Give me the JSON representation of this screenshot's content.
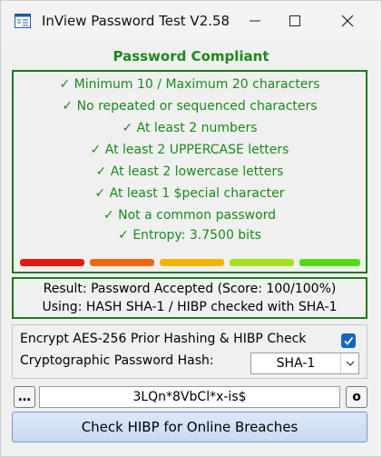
{
  "window": {
    "title": "InView Password Test V2.58"
  },
  "status": {
    "title": "Password Compliant"
  },
  "rules": [
    "✓ Minimum 10 / Maximum 20 characters",
    "✓ No repeated or sequenced characters",
    "✓ At least 2 numbers",
    "✓ At least 2 UPPERCASE letters",
    "✓ At least 2 lowercase letters",
    "✓ At least 1 $pecial character",
    "✓ Not a common password",
    "✓ Entropy: 3.7500 bits"
  ],
  "strength_meter": {
    "colors": [
      "#e31b0c",
      "#f06a10",
      "#f5b400",
      "#a8e020",
      "#50dc10"
    ],
    "level": 5
  },
  "result": {
    "line1": "Result: Password Accepted (Score: 100/100%)",
    "line2": "Using: HASH SHA-1 / HIBP checked with SHA-1"
  },
  "options": {
    "encrypt_label": "Encrypt AES-256 Prior Hashing & HIBP Check",
    "encrypt_checked": true,
    "hash_label": "Cryptographic Password Hash:",
    "hash_value": "SHA-1"
  },
  "password": {
    "more_button": "…",
    "value": "3LQn*8VbCl*x-is$",
    "clear_button": "o"
  },
  "actions": {
    "check_hibp": "Check HIBP for Online Breaches"
  }
}
